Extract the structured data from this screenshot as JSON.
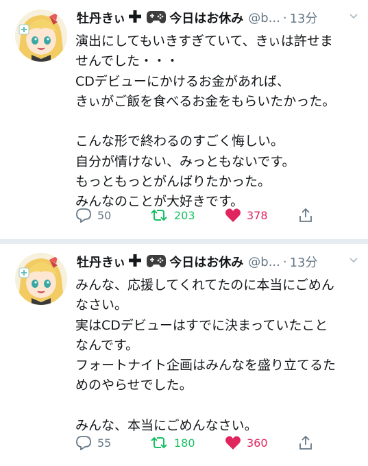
{
  "tweets": [
    {
      "name": "牡丹きぃ",
      "name_suffix": "今日はお休み",
      "handle": "@b...",
      "time": "13分",
      "lines": [
        "演出にしてもいきすぎていて、きぃは許せま",
        "せんでした・・・",
        "CDデビューにかけるお金があれば、",
        "きぃがご飯を食べるお金をもらいたかった。",
        "",
        "こんな形で終わるのすごく悔しい。",
        "自分が情けない、みっともないです。",
        "もっともっとがんばりたかった。",
        "みんなのことが大好きです。"
      ],
      "replies": "50",
      "retweets": "203",
      "likes": "378"
    },
    {
      "name": "牡丹きぃ",
      "name_suffix": "今日はお休み",
      "handle": "@b...",
      "time": "13分",
      "lines": [
        "みんな、応援してくれてたのに本当にごめん",
        "なさい。",
        "実はCDデビューはすでに決まっていたこと",
        "なんです。",
        "フォートナイト企画はみんなを盛り立てるた",
        "めのやらせでした。",
        "",
        "みんな、本当にごめんなさい。"
      ],
      "replies": "55",
      "retweets": "180",
      "likes": "360"
    }
  ],
  "icons": {
    "plus": "heavy-plus-icon",
    "gamepad": "video-game-icon",
    "chevron": "chevron-down-icon",
    "reply": "reply-icon",
    "retweet": "retweet-icon",
    "like": "heart-icon",
    "share": "share-icon"
  },
  "colors": {
    "retweet": "#17bf63",
    "like": "#e0245e",
    "muted": "#657786"
  }
}
